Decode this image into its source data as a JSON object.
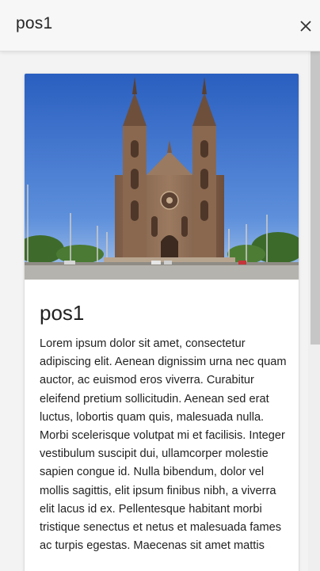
{
  "header": {
    "title": "pos1",
    "close_glyph": "×"
  },
  "card": {
    "image_icon": "cathedral-photo",
    "title": "pos1",
    "body": "Lorem ipsum dolor sit amet, consectetur adipiscing elit. Aenean dignissim urna nec quam auctor, ac euismod eros viverra. Curabitur eleifend pretium sollicitudin. Aenean sed erat luctus, lobortis quam quis, malesuada nulla. Morbi scelerisque volutpat mi et facilisis. Integer vestibulum suscipit dui, ullamcorper molestie sapien congue id. Nulla bibendum, dolor vel mollis sagittis, elit ipsum finibus nibh, a viverra elit lacus id ex. Pellentesque habitant morbi tristique senectus et netus et malesuada fames ac turpis egestas. Maecenas sit amet mattis"
  },
  "colors": {
    "sky_top": "#2a64c6",
    "sky_bottom": "#8fb6e6",
    "stone": "#8c6a52"
  }
}
